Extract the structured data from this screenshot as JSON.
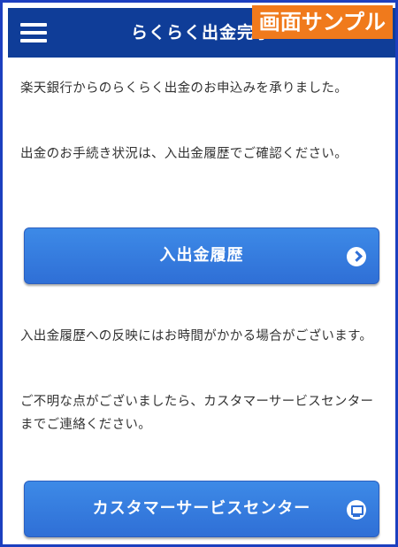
{
  "header": {
    "menu_icon": "hamburger-menu-icon",
    "title": "らくらく出金完了"
  },
  "badge": {
    "text": "画面サンプル",
    "color": "#f07a1c"
  },
  "content": {
    "para1": "楽天銀行からのらくらく出金のお申込みを承りました。",
    "para2": "出金のお手続き状況は、入出金履歴でご確認ください。",
    "para3": "入出金履歴への反映にはお時間がかかる場合がございます。",
    "para4": "ご不明な点がございましたら、カスタマーサービスセンターまでご連絡ください。"
  },
  "buttons": {
    "history": {
      "label": "入出金履歴",
      "icon": "chevron-right-circle-icon"
    },
    "customer_service": {
      "label": "カスタマーサービスセンター",
      "icon": "monitor-icon"
    }
  },
  "colors": {
    "header_bg": "#0f3d98",
    "button_bg": "#3a82e4",
    "frame_border": "#1c3fbf"
  }
}
